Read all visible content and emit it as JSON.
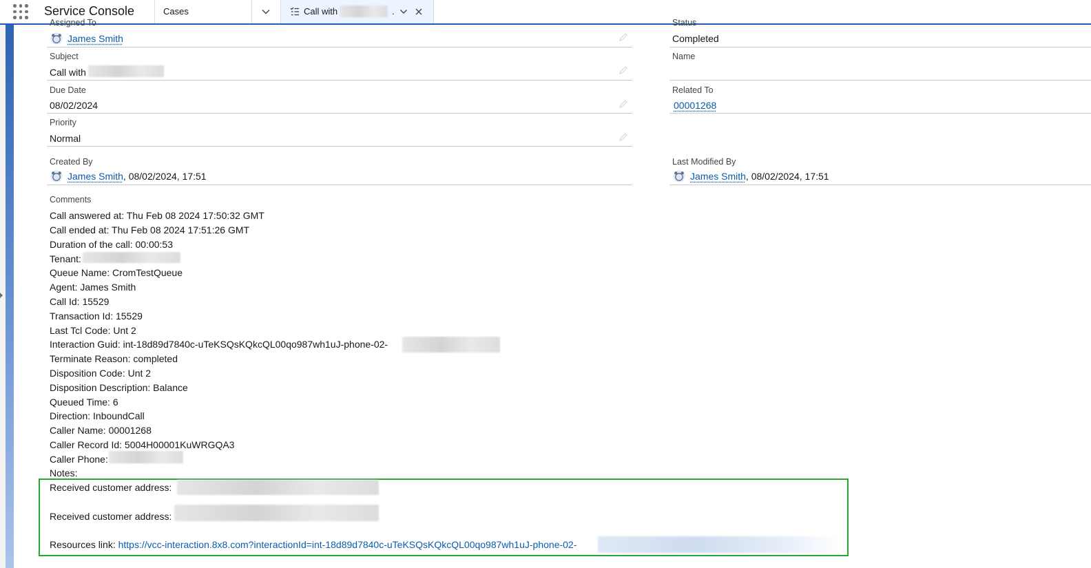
{
  "header": {
    "app_name": "Service Console",
    "tabs": [
      {
        "label": "Cases"
      },
      {
        "label": "Call with",
        "suffix": "."
      }
    ]
  },
  "fields": {
    "assigned_to": {
      "label": "Assigned To",
      "value": "James Smith"
    },
    "status": {
      "label": "Status",
      "value": "Completed"
    },
    "subject": {
      "label": "Subject",
      "value": "Call with"
    },
    "name": {
      "label": "Name",
      "value": ""
    },
    "due_date": {
      "label": "Due Date",
      "value": "08/02/2024"
    },
    "related_to": {
      "label": "Related To",
      "value": "00001268"
    },
    "priority": {
      "label": "Priority",
      "value": "Normal"
    },
    "created_by": {
      "label": "Created By",
      "user": "James Smith",
      "date": ", 08/02/2024, 17:51"
    },
    "last_modified_by": {
      "label": "Last Modified By",
      "user": "James Smith",
      "date": ", 08/02/2024, 17:51"
    }
  },
  "comments": {
    "label": "Comments",
    "lines": [
      "Call answered at: Thu Feb 08 2024 17:50:32 GMT",
      "Call ended at: Thu Feb 08 2024 17:51:26 GMT",
      "Duration of the call: 00:00:53",
      "Tenant:",
      "Queue Name: CromTestQueue",
      "Agent: James Smith",
      "Call Id: 15529",
      "Transaction Id: 15529",
      "Last Tcl Code: Unt 2",
      "Interaction Guid: int-18d89d7840c-uTeKSQsKQkcQL00qo987wh1uJ-phone-02-",
      "Terminate Reason: completed",
      "Disposition Code: Unt 2",
      "Disposition Description: Balance",
      "Queued Time: 6",
      "Direction: InboundCall",
      "Caller Name: 00001268",
      "Caller Record Id: 5004H00001KuWRGQA3",
      "Caller Phone:",
      "Notes:"
    ],
    "highlighted": {
      "address1_label": "Received customer address:",
      "address2_label": "Received customer address:",
      "resources_label": "Resources link: ",
      "resources_url": "https://vcc-interaction.8x8.com?interactionId=int-18d89d7840c-uTeKSQsKQkcQL00qo987wh1uJ-phone-02-"
    }
  },
  "colors": {
    "brand_blue": "#1b5fb8",
    "link": "#0b5cab",
    "highlight_border": "#2aa339"
  },
  "icons": [
    "app-launcher-icon",
    "chevron-down-icon",
    "task-list-icon",
    "close-icon",
    "pencil-icon",
    "user-avatar-icon"
  ]
}
